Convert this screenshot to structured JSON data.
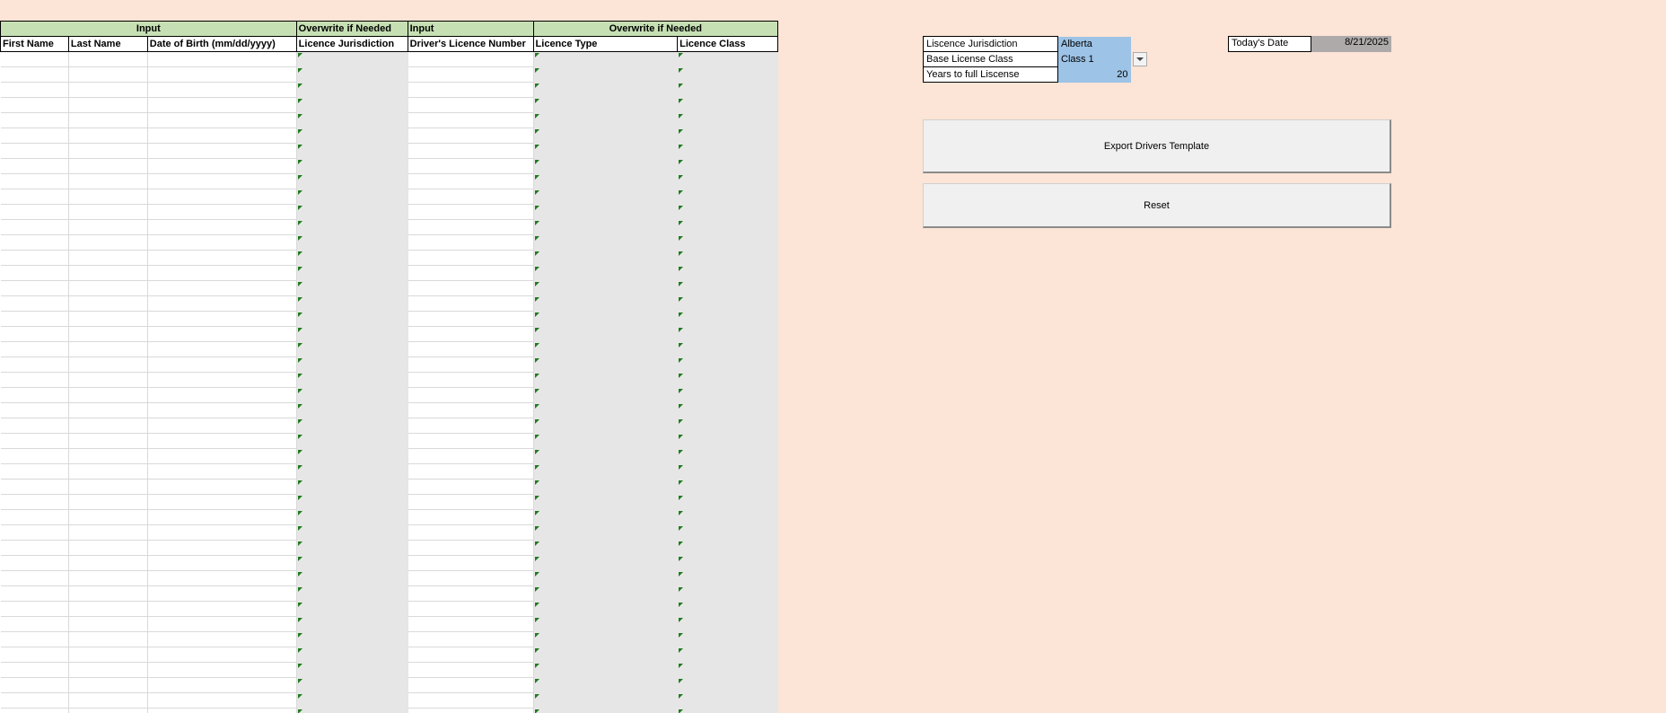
{
  "table": {
    "group_headers": [
      {
        "label": "Input",
        "colspan": 3
      },
      {
        "label": "Overwrite if Needed",
        "colspan": 1
      },
      {
        "label": "Input",
        "colspan": 1
      },
      {
        "label": "Overwrite if Needed",
        "colspan": 2
      }
    ],
    "columns": [
      "First Name",
      "Last Name",
      "Date of Birth (mm/dd/yyyy)",
      "Licence Jurisdiction",
      "Driver's Licence Number",
      "Licence Type",
      "Licence Class"
    ],
    "row_count": 44
  },
  "settings": {
    "rows": [
      {
        "label": "Liscence Jurisdiction",
        "value": "Alberta"
      },
      {
        "label": "Base License Class",
        "value": "Class 1"
      },
      {
        "label": "Years to full Liscense",
        "value": "20"
      }
    ]
  },
  "today": {
    "label": "Today's Date",
    "value": "8/21/2025"
  },
  "buttons": {
    "export": "Export Drivers Template",
    "reset": "Reset"
  },
  "colors": {
    "background": "#fce4d6",
    "header_green": "#c6e0b4",
    "input_blue": "#9dc3e6",
    "locked_gray": "#e7e6e6",
    "date_gray": "#aeaaaa"
  }
}
